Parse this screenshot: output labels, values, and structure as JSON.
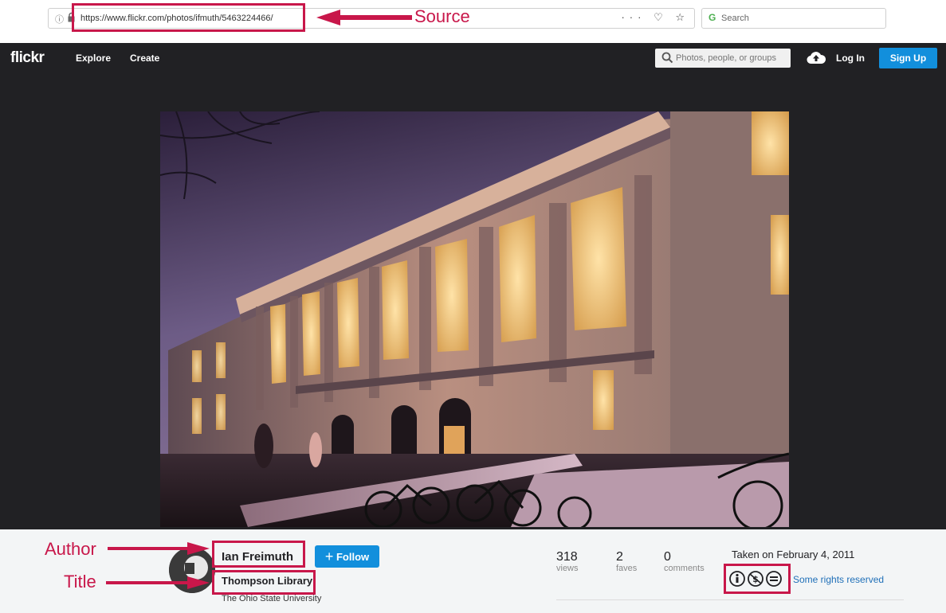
{
  "browser": {
    "url": "https://www.flickr.com/photos/ifmuth/5463224466/",
    "info_glyph": "ⓘ",
    "actions": "··· ♡ ☆",
    "search_placeholder": "Search"
  },
  "nav": {
    "logo": "flickr",
    "explore": "Explore",
    "create": "Create",
    "search_placeholder": "Photos, people, or groups",
    "login": "Log In",
    "signup": "Sign Up"
  },
  "annotations": {
    "source": "Source",
    "author": "Author",
    "title": "Title",
    "color": "#c8174a"
  },
  "photo": {
    "author": "Ian Freimuth",
    "follow": "Follow",
    "title": "Thompson Library",
    "description": "The Ohio State University",
    "stats": [
      {
        "value": "318",
        "label": "views"
      },
      {
        "value": "2",
        "label": "faves"
      },
      {
        "value": "0",
        "label": "comments"
      }
    ],
    "taken": "Taken on February 4, 2011",
    "license_icons": [
      "cc-by-icon",
      "cc-nc-icon",
      "cc-nd-icon"
    ],
    "rights": "Some rights reserved"
  },
  "colors": {
    "nav_bg": "#212124",
    "accent": "#128fdc",
    "annotation": "#c8174a"
  }
}
